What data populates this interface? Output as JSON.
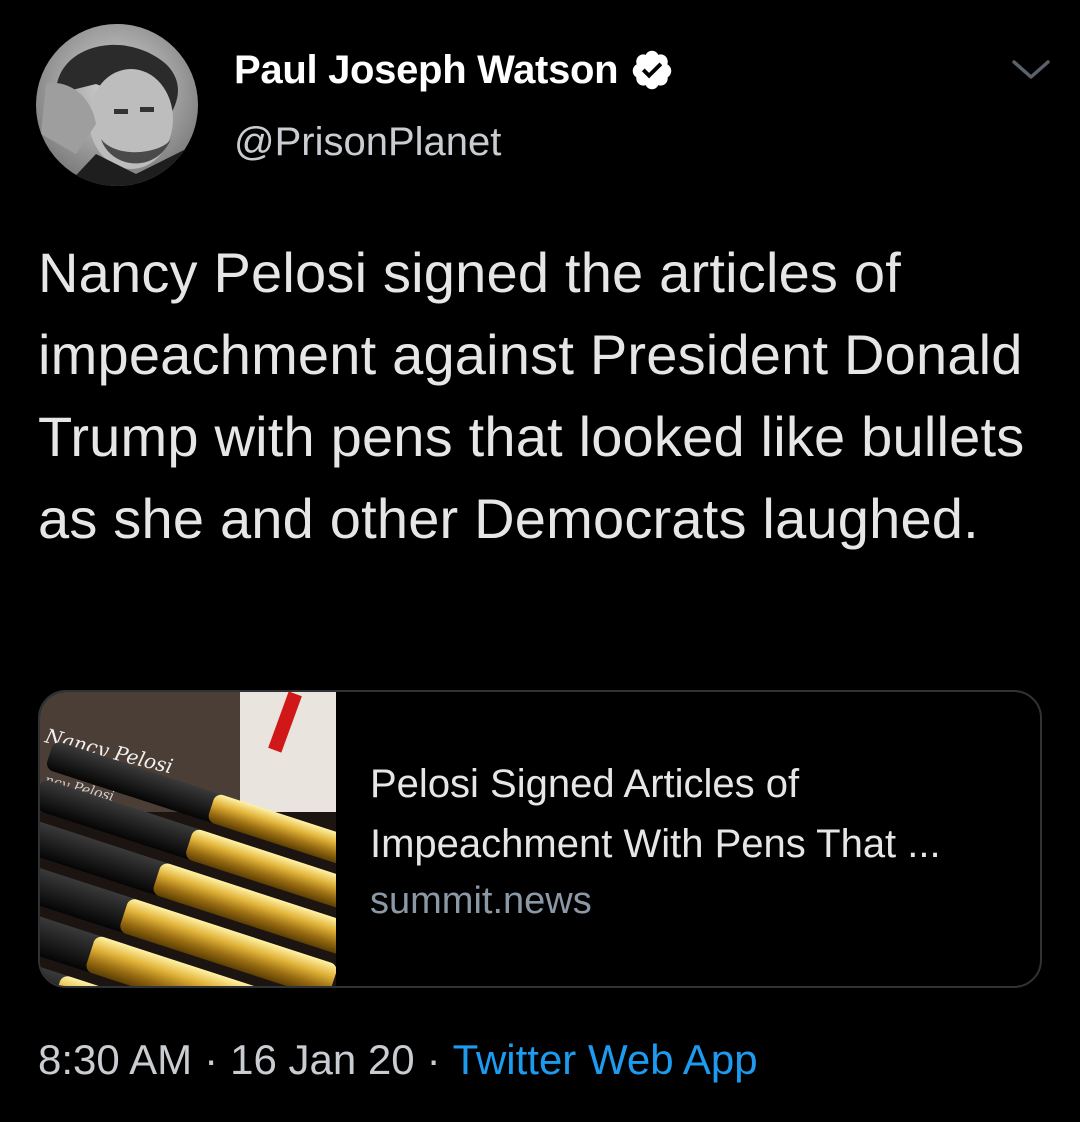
{
  "author": {
    "name": "Paul Joseph Watson",
    "handle": "@PrisonPlanet",
    "verified": true,
    "avatar_icon": "avatar-photo"
  },
  "tweet": {
    "text": "Nancy Pelosi signed the articles of impeachment against President Donald Trump with pens that looked like bullets as she and other Democrats laughed."
  },
  "link_card": {
    "title": "Pelosi Signed Articles of Impeachment With Pens That ...",
    "domain": "summit.news",
    "thumbnail_icon": "gold-pens-thumbnail",
    "thumbnail_signature": "Nancy Pelosi"
  },
  "meta": {
    "time": "8:30 AM",
    "date": "16 Jan 20",
    "separator": "·",
    "source": "Twitter Web App"
  },
  "colors": {
    "background": "#000000",
    "text": "#e6e6e6",
    "muted": "#c9ccd0",
    "accent": "#1d9bf0",
    "verified_badge": "#ffffff",
    "card_border": "#2f3336"
  }
}
